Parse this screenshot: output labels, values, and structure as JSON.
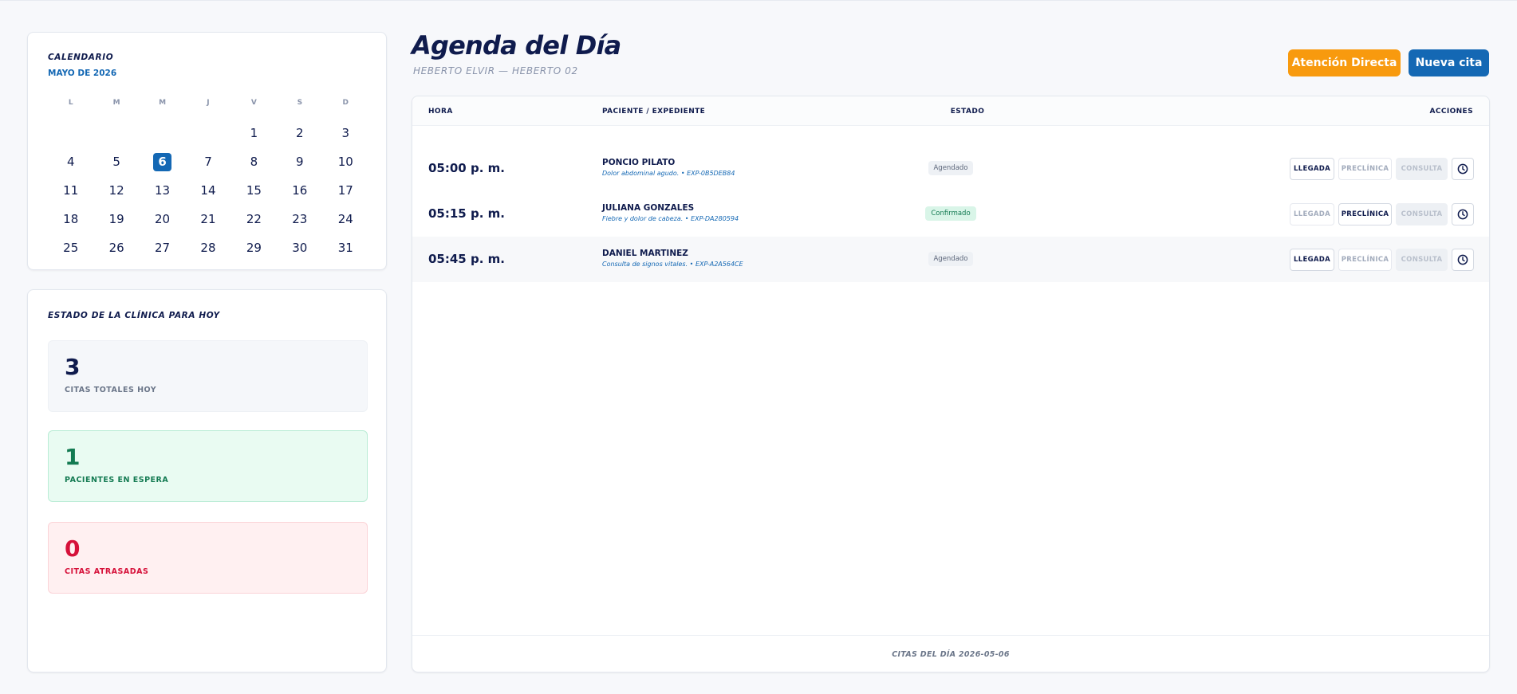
{
  "calendar": {
    "title": "CALENDARIO",
    "month": "MAYO DE 2026",
    "weekdays": [
      "L",
      "M",
      "M",
      "J",
      "V",
      "S",
      "D"
    ],
    "weeks": [
      [
        "",
        "",
        "",
        "",
        "1",
        "2",
        "3"
      ],
      [
        "4",
        "5",
        "6",
        "7",
        "8",
        "9",
        "10"
      ],
      [
        "11",
        "12",
        "13",
        "14",
        "15",
        "16",
        "17"
      ],
      [
        "18",
        "19",
        "20",
        "21",
        "22",
        "23",
        "24"
      ],
      [
        "25",
        "26",
        "27",
        "28",
        "29",
        "30",
        "31"
      ]
    ],
    "selected_day": "6"
  },
  "stats": {
    "title": "ESTADO DE LA CLÍNICA PARA HOY",
    "total": {
      "value": "3",
      "label": "CITAS TOTALES HOY"
    },
    "waiting": {
      "value": "1",
      "label": "PACIENTES EN ESPERA"
    },
    "late": {
      "value": "0",
      "label": "CITAS ATRASADAS"
    }
  },
  "header": {
    "title": "Agenda del Día",
    "subtitle": "HEBERTO ELVIR — HEBERTO 02",
    "direct_label": "Atención Directa",
    "new_label": "Nueva cita"
  },
  "table": {
    "headers": {
      "hora": "HORA",
      "paciente": "PACIENTE / EXPEDIENTE",
      "estado": "ESTADO",
      "acciones": "ACCIONES"
    },
    "actions": {
      "llegada": "LLEGADA",
      "preclinica": "PRECLÍNICA",
      "consulta": "CONSULTA"
    },
    "rows": [
      {
        "time": "05:00 p. m.",
        "name": "PONCIO PILATO",
        "detail": "Dolor abdominal agudo. • EXP-0B5DEB84",
        "status": "Agendado"
      },
      {
        "time": "05:15 p. m.",
        "name": "JULIANA GONZALES",
        "detail": "Fiebre y dolor de cabeza. • EXP-DA280594",
        "status": "Confirmado"
      },
      {
        "time": "05:45 p. m.",
        "name": "DANIEL MARTINEZ",
        "detail": "Consulta de signos vitales. • EXP-A2A564CE",
        "status": "Agendado"
      }
    ],
    "footer": "CITAS DEL DÍA 2026-05-06"
  },
  "colors": {
    "primary": "#1468b4",
    "accent_orange": "#f89a0e",
    "navy_text": "#0f1b4d",
    "waiting_green": "#137a52",
    "late_red": "#d6113a"
  },
  "icons": [
    "clock-icon"
  ]
}
